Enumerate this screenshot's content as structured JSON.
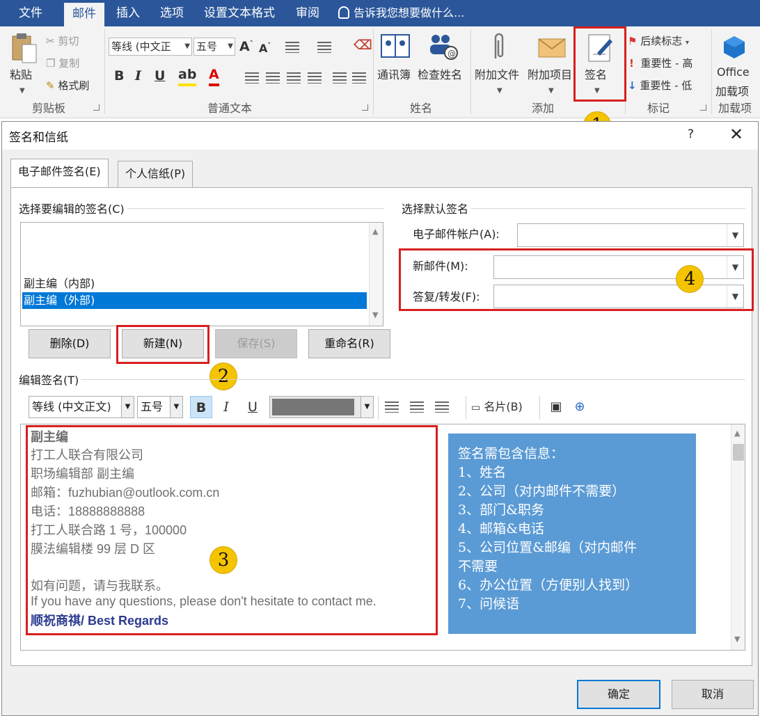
{
  "ribbon": {
    "tabs": [
      "文件",
      "邮件",
      "插入",
      "选项",
      "设置文本格式",
      "审阅"
    ],
    "active_tab": "邮件",
    "tell_me": "告诉我您想要做什么...",
    "clipboard": {
      "paste": "粘贴",
      "cut": "剪切",
      "copy": "复制",
      "format_painter": "格式刷",
      "label": "剪贴板"
    },
    "basic_text": {
      "font": "等线 (中文正",
      "size": "五号",
      "label": "普通文本"
    },
    "names": {
      "address_book": "通讯簿",
      "check_names": "检查姓名",
      "label": "姓名"
    },
    "include": {
      "attach_file": "附加文件",
      "attach_item": "附加项目",
      "signature": "签名",
      "label": "添加"
    },
    "tags": {
      "follow_up": "后续标志",
      "high": "重要性 - 高",
      "low": "重要性 - 低",
      "label": "标记"
    },
    "addins": {
      "office_line1": "Office",
      "office_line2": "加载项",
      "label": "加载项"
    }
  },
  "callouts": [
    "1",
    "2",
    "3",
    "4"
  ],
  "dialog": {
    "title": "签名和信纸",
    "help": "?",
    "close": "✕",
    "tabs": [
      "电子邮件签名(E)",
      "个人信纸(P)"
    ],
    "select_signature_label": "选择要编辑的签名(C)",
    "signatures": [
      "副主编（内部)",
      "副主编（外部)"
    ],
    "selected_signature": "副主编（外部)",
    "buttons": {
      "delete": "删除(D)",
      "new": "新建(N)",
      "save": "保存(S)",
      "rename": "重命名(R)"
    },
    "default_signature_label": "选择默认签名",
    "email_account_label": "电子邮件帐户(A):",
    "email_account_value": "",
    "new_messages_label": "新邮件(M):",
    "new_messages_value": "",
    "replies_label": "答复/转发(F):",
    "replies_value": "",
    "edit_signature_label": "编辑签名(T)",
    "editor_toolbar": {
      "font": "等线 (中文正文)",
      "size": "五号",
      "bold": "B",
      "italic": "I",
      "underline": "U",
      "business_card": "名片(B)"
    },
    "signature_text": {
      "name": "副主编",
      "company": "打工人联合有限公司",
      "dept_title": "职场编辑部  副主编",
      "email": "邮箱：fuzhubian@outlook.com.cn",
      "phone": "电话：18888888888",
      "address": "打工人联合路 1 号，100000",
      "office": "膜法编辑楼 99 层 D 区",
      "contact_cn": "如有问题，请与我联系。",
      "contact_en": "If you have any questions, please don't hesitate to contact me.",
      "regards": "顺祝商祺/ Best Regards"
    },
    "info_box": {
      "title": "签名需包含信息：",
      "items": [
        "1、姓名",
        "2、公司（对内邮件不需要）",
        "3、部门&职务",
        "4、邮箱&电话",
        "5、公司位置&邮编（对内邮件",
        "不需要",
        "6、办公位置（方便别人找到）",
        "7、问候语"
      ]
    },
    "ok": "确定",
    "cancel": "取消"
  },
  "colors": {
    "ribbon_blue": "#2b579a",
    "highlight_red": "#d81e1e",
    "callout_yellow": "#f5c400",
    "info_box_blue": "#5b9bd5",
    "selection_blue": "#0078d7",
    "regards_blue": "#2b3a8f"
  }
}
